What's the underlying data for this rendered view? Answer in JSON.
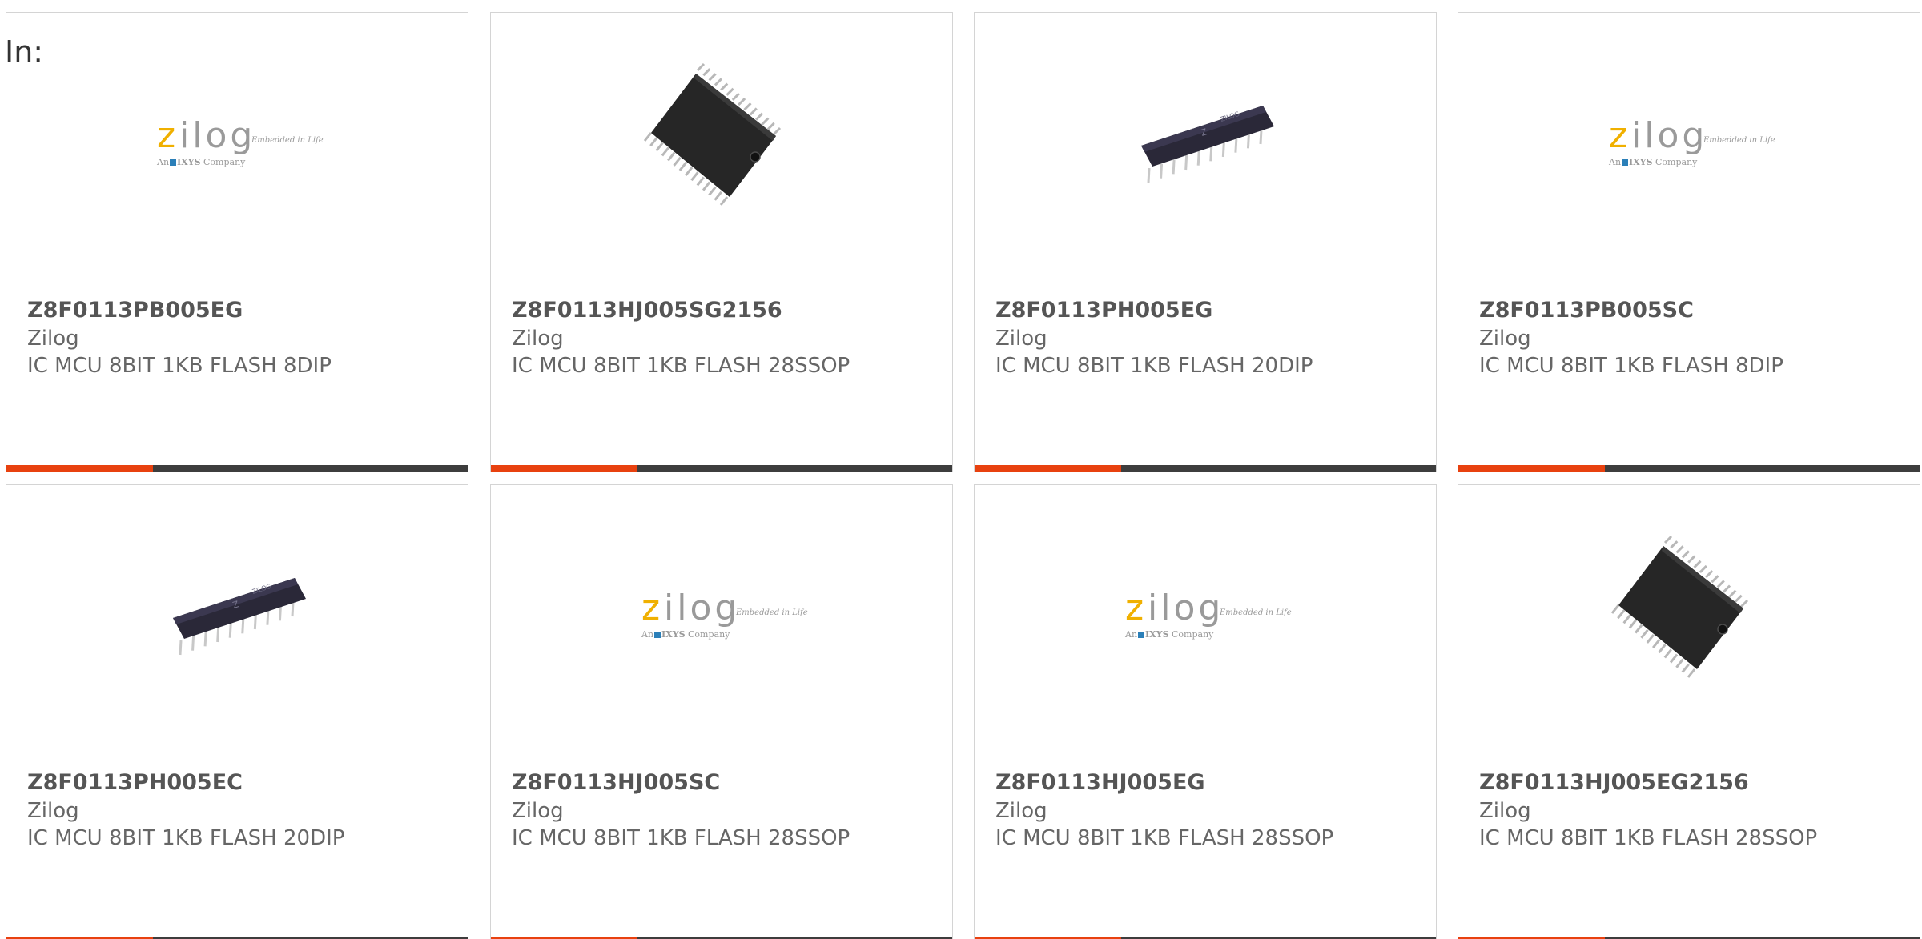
{
  "header": {
    "label": "In:"
  },
  "colors": {
    "accent": "#e8410f",
    "bar_dark": "#3d3d3d",
    "logo_z": "#f0b000",
    "logo_text": "#9a9a9a",
    "logo_square": "#2b7fb8"
  },
  "logo": {
    "z": "z",
    "rest": "ilog",
    "tagline": "Embedded in Life",
    "sub_prefix": "An",
    "sub_brand": "IXYS",
    "sub_suffix": "Company"
  },
  "products": [
    {
      "part": "Z8F0113PB005EG",
      "manufacturer": "Zilog",
      "description": "IC MCU 8BIT 1KB FLASH 8DIP",
      "image": "zilog-logo"
    },
    {
      "part": "Z8F0113HJ005SG2156",
      "manufacturer": "Zilog",
      "description": "IC MCU 8BIT 1KB FLASH 28SSOP",
      "image": "ssop-chip"
    },
    {
      "part": "Z8F0113PH005EG",
      "manufacturer": "Zilog",
      "description": "IC MCU 8BIT 1KB FLASH 20DIP",
      "image": "dip-chip"
    },
    {
      "part": "Z8F0113PB005SC",
      "manufacturer": "Zilog",
      "description": "IC MCU 8BIT 1KB FLASH 8DIP",
      "image": "zilog-logo"
    },
    {
      "part": "Z8F0113PH005EC",
      "manufacturer": "Zilog",
      "description": "IC MCU 8BIT 1KB FLASH 20DIP",
      "image": "dip-chip"
    },
    {
      "part": "Z8F0113HJ005SC",
      "manufacturer": "Zilog",
      "description": "IC MCU 8BIT 1KB FLASH 28SSOP",
      "image": "zilog-logo"
    },
    {
      "part": "Z8F0113HJ005EG",
      "manufacturer": "Zilog",
      "description": "IC MCU 8BIT 1KB FLASH 28SSOP",
      "image": "zilog-logo"
    },
    {
      "part": "Z8F0113HJ005EG2156",
      "manufacturer": "Zilog",
      "description": "IC MCU 8BIT 1KB FLASH 28SSOP",
      "image": "ssop-chip"
    }
  ]
}
